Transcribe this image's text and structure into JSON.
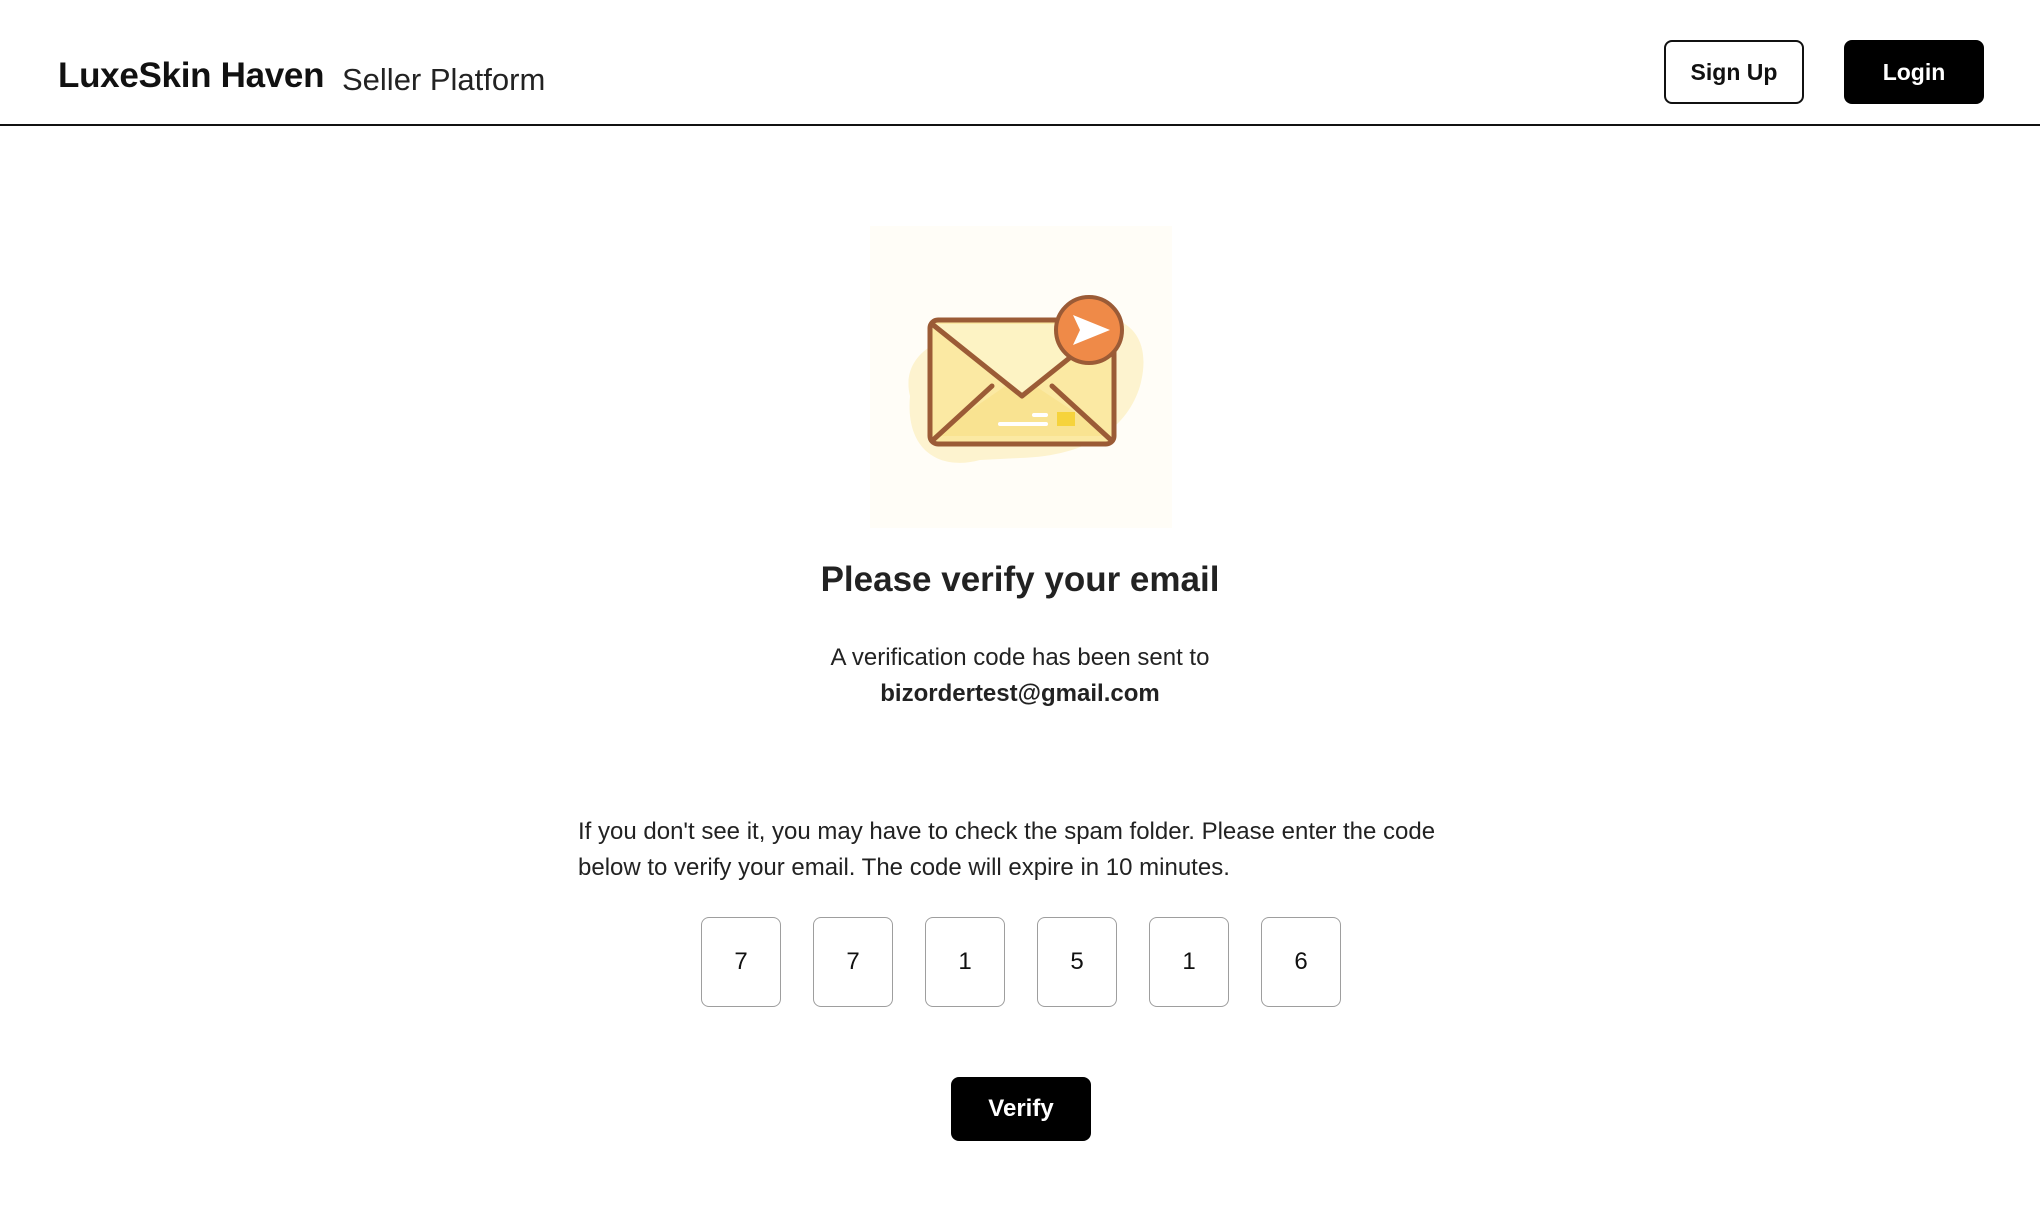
{
  "header": {
    "brand": "LuxeSkin Haven",
    "platform": "Seller Platform",
    "signup_label": "Sign Up",
    "login_label": "Login"
  },
  "illustration": {
    "icon": "email-sent-icon",
    "colors": {
      "envelope_fill": "#fbe9a3",
      "envelope_stroke": "#9b5b36",
      "badge": "#ef8a48",
      "blob": "#fdf3cf"
    }
  },
  "main": {
    "title": "Please verify your email",
    "sent_text": "A verification code has been sent to",
    "email": "bizordertest@gmail.com",
    "instructions": "If you don't see it, you may have to check the spam folder. Please enter the code below to verify your email. The code will expire in 10 minutes.",
    "code_digits": [
      "7",
      "7",
      "1",
      "5",
      "1",
      "6"
    ],
    "verify_label": "Verify"
  },
  "colors": {
    "primary_button": "#000000",
    "primary_button_text": "#ffffff",
    "text": "#222222",
    "input_border": "#9e9e9e"
  }
}
